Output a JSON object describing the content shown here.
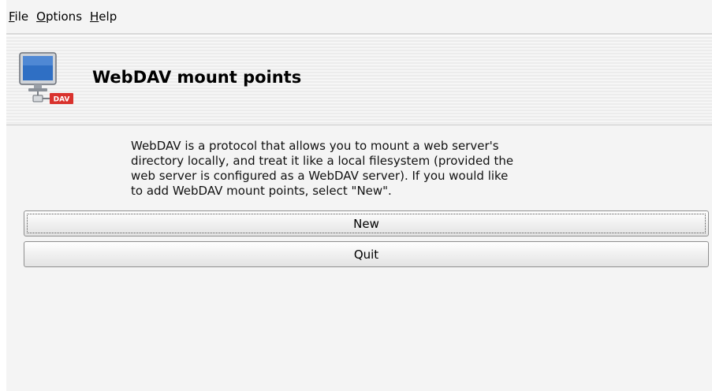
{
  "menubar": {
    "items": [
      {
        "mnemonic": "F",
        "rest": "ile"
      },
      {
        "mnemonic": "O",
        "rest": "ptions"
      },
      {
        "mnemonic": "H",
        "rest": "elp"
      }
    ]
  },
  "banner": {
    "title": "WebDAV mount points",
    "icon": "monitor-network-dav-icon",
    "icon_badge": "DAV"
  },
  "main": {
    "description": "WebDAV is a protocol that allows you to mount a web server's\ndirectory locally, and treat it like a local filesystem (provided the\nweb server is configured as a WebDAV server). If you would like\nto add WebDAV mount points, select \"New\".",
    "new_label": "New",
    "quit_label": "Quit"
  },
  "colors": {
    "badge_red": "#d9322d",
    "screen_blue": "#2f6fc4"
  }
}
